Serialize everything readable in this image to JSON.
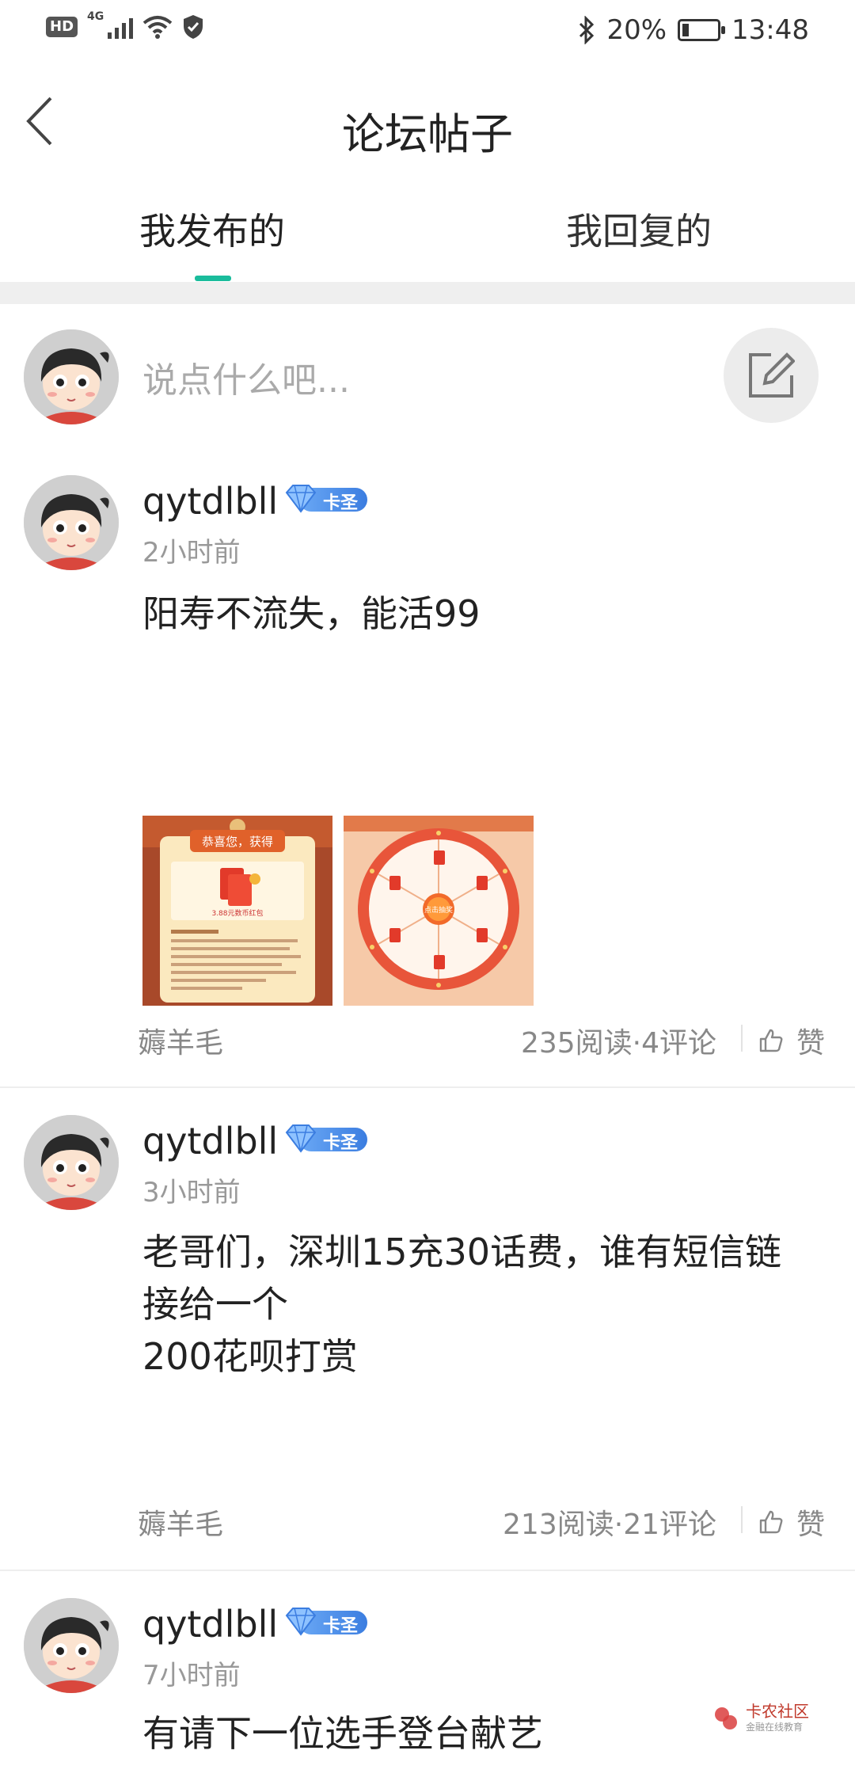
{
  "status": {
    "hd": "HD",
    "network": "4G",
    "battery": "20%",
    "battery_level": 0.2,
    "time": "13:48"
  },
  "header": {
    "title": "论坛帖子"
  },
  "tabs": [
    {
      "label": "我发布的",
      "active": true
    },
    {
      "label": "我回复的",
      "active": false
    }
  ],
  "composer": {
    "placeholder": "说点什么吧..."
  },
  "accent": "#1abc9c",
  "posts": [
    {
      "username": "qytdlbll",
      "badge": "卡圣",
      "time": "2小时前",
      "content": "阳寿不流失，能活99",
      "images": [
        {
          "heading": "恭喜您，获得",
          "label": "3.88元数币红包"
        },
        {
          "label": "点击抽奖"
        }
      ],
      "tag": "薅羊毛",
      "stats": "235阅读·4评论",
      "like": "赞"
    },
    {
      "username": "qytdlbll",
      "badge": "卡圣",
      "time": "3小时前",
      "content": "老哥们，深圳15充30话费，谁有短信链\n接给一个\n200花呗打赏",
      "tag": "薅羊毛",
      "stats": "213阅读·21评论",
      "like": "赞"
    },
    {
      "username": "qytdlbll",
      "badge": "卡圣",
      "time": "7小时前",
      "content": "有请下一位选手登台献艺"
    }
  ],
  "watermark": {
    "title": "卡农社区",
    "subtitle": "金融在线教育"
  }
}
